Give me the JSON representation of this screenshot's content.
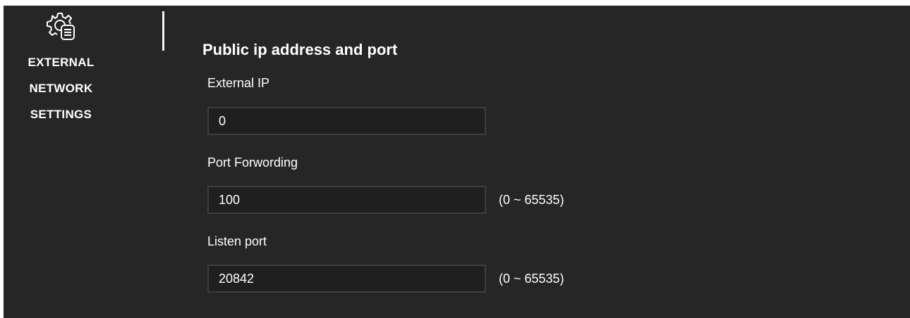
{
  "sidebar": {
    "icon": "settings-gear-list-icon",
    "lines": [
      "EXTERNAL",
      "NETWORK",
      "SETTINGS"
    ]
  },
  "main": {
    "section_title": "Public ip address and port",
    "fields": [
      {
        "label": "External IP",
        "value": "0",
        "range": ""
      },
      {
        "label": "Port Forwording",
        "value": "100",
        "range": "(0 ~ 65535)"
      },
      {
        "label": "Listen port",
        "value": "20842",
        "range": "(0 ~ 65535)"
      }
    ]
  },
  "colors": {
    "background": "#262627",
    "input_background": "#1f1f20",
    "input_border": "#3e3e40",
    "text": "#ffffff"
  }
}
